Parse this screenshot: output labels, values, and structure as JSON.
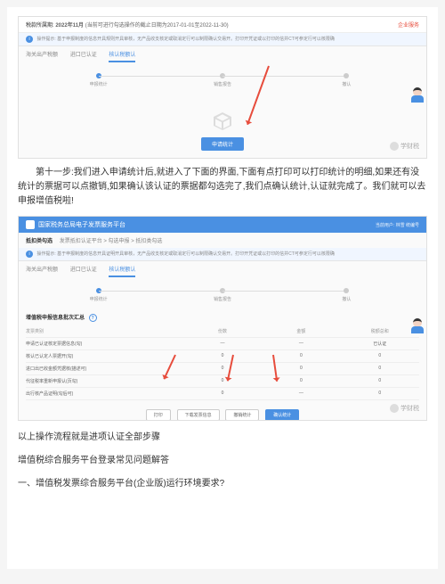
{
  "screenshot1": {
    "period_label": "税款所属期:",
    "period_value": "2022年11月",
    "period_note": "(当前可进行勾选操作的截止日期为2017-01-01至2022-11-30)",
    "right_link": "企业服务",
    "info_prefix": "操作提示:",
    "info_text": "基于申报制度的信息开具规则开具审核，无产品收支核定或取消定行可以制限确认交易开。打印开凭证或以打印的信并CT可参定行可以核限确",
    "tabs": [
      "海关出产税额",
      "进口已认证",
      "核认税额认"
    ],
    "steps": [
      "申报统计",
      "销售报告",
      "撤认"
    ],
    "button": "申请统计",
    "watermark": "学财税"
  },
  "step11_text": "第十一步:我们进入申请统计后,就进入了下面的界面,下面有点打印可以打印统计的明细,如果还有没统计的票据可以点撤销,如果确认该认证的票据都勾选完了,我们点确认统计,认证就完成了。我们就可以去申报增值税啦!",
  "screenshot2": {
    "titlebar": "国家税务总局电子发票服务平台",
    "titlebar_right": "当前用户: 林雪 统编号",
    "crumb_title": "抵扣类勾选",
    "crumb_path": "发票抵扣认证平台 > 勾选申报 > 抵扣类勾选",
    "info_prefix": "操作提示:",
    "info_text": "基于申报制度的信息开具证明开具审核，无产品收支核定或取消定行可以制限确认交易开。打印开凭证或以打印的信并CT可参定行可以核限确",
    "tabs": [
      "海关出产税额",
      "进口已认证",
      "核认税额认"
    ],
    "steps": [
      "申报统计",
      "销售报告",
      "撤认"
    ],
    "section_title": "增值税申报信息批次汇总",
    "table_head": [
      "发票类别",
      "份数",
      "金额",
      "税额总和"
    ],
    "rows": [
      {
        "c1": "申请已认证核定票据信息(勾)",
        "c2": "—",
        "c3": "—",
        "c4": "已认证"
      },
      {
        "c1": "核认已认定人票据开(勾)",
        "c2": "0",
        "c3": "0",
        "c4": "0"
      },
      {
        "c1": "进口出已收金额凭据核(描述可)",
        "c2": "0",
        "c3": "0",
        "c4": "0"
      },
      {
        "c1": "代征税率重新申报认(页勾)",
        "c2": "0",
        "c3": "0",
        "c4": "0"
      },
      {
        "c1": "出行核产品证明(勾后可)",
        "c2": "0",
        "c3": "—",
        "c4": "0"
      }
    ],
    "buttons": [
      "打印",
      "下载发票信息",
      "撤销统计",
      "确认统计"
    ],
    "watermark": "学财税"
  },
  "footer": {
    "line1": "以上操作流程就是进项认证全部步骤",
    "line2": "增值税综合服务平台登录常见问题解答",
    "line3": "一、增值税发票综合服务平台(企业版)运行环境要求?"
  }
}
